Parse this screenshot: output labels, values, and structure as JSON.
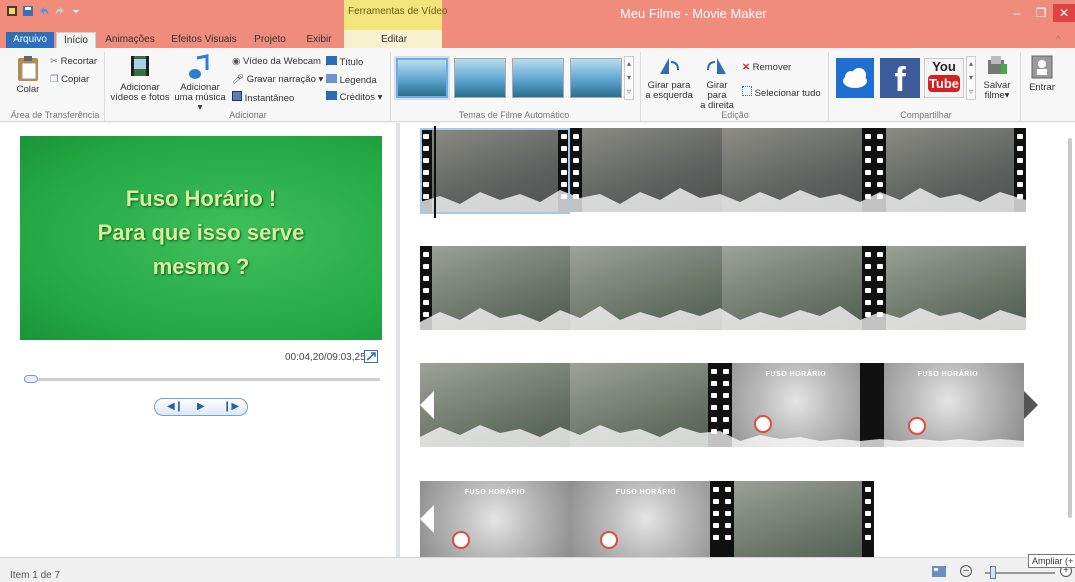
{
  "window": {
    "title": "Meu Filme - Movie Maker",
    "context_tab": "Ferramentas de Vídeo",
    "accent": "#f08c7c",
    "file_tab_color": "#2b6fbd"
  },
  "tabs": [
    {
      "label": "Arquivo"
    },
    {
      "label": "Início"
    },
    {
      "label": "Animações"
    },
    {
      "label": "Efeitos Visuais"
    },
    {
      "label": "Projeto"
    },
    {
      "label": "Exibir"
    },
    {
      "label": "Editar"
    }
  ],
  "ribbon": {
    "clipboard": {
      "group_label": "Área de Transferência",
      "colar": "Colar",
      "recortar": "Recortar",
      "copiar": "Copiar"
    },
    "adicionar": {
      "group_label": "Adicionar",
      "add_videos_line1": "Adicionar",
      "add_videos_line2": "vídeos e fotos",
      "add_music_line1": "Adicionar",
      "add_music_line2": "uma música",
      "webcam": "Vídeo da Webcam",
      "narracao": "Gravar narração",
      "instantaneo": "Instantâneo",
      "titulo": "Título",
      "legenda": "Legenda",
      "creditos": "Créditos"
    },
    "temas": {
      "group_label": "Temas de Filme Automático"
    },
    "edicao": {
      "group_label": "Edição",
      "girar_esq_1": "Girar para",
      "girar_esq_2": "a esquerda",
      "girar_dir_1": "Girar para",
      "girar_dir_2": "a direita",
      "remover": "Remover",
      "selecionar_tudo": "Selecionar tudo"
    },
    "compartilhar": {
      "group_label": "Compartilhar",
      "salvar_1": "Salvar",
      "salvar_2": "filme",
      "entrar": "Entrar",
      "youtube_1": "You",
      "youtube_2": "Tube",
      "facebook": "f"
    }
  },
  "preview": {
    "slide_lines": [
      "Fuso Horário !",
      "Para que isso serve",
      "mesmo ?"
    ],
    "timecode": "00:04,20/09:03,25"
  },
  "storyboard": {
    "title_clip_text": "FUSO HORÁRIO"
  },
  "status": {
    "item_text": "Item 1 de 7",
    "zoom_tooltip": "Ampliar (+"
  }
}
